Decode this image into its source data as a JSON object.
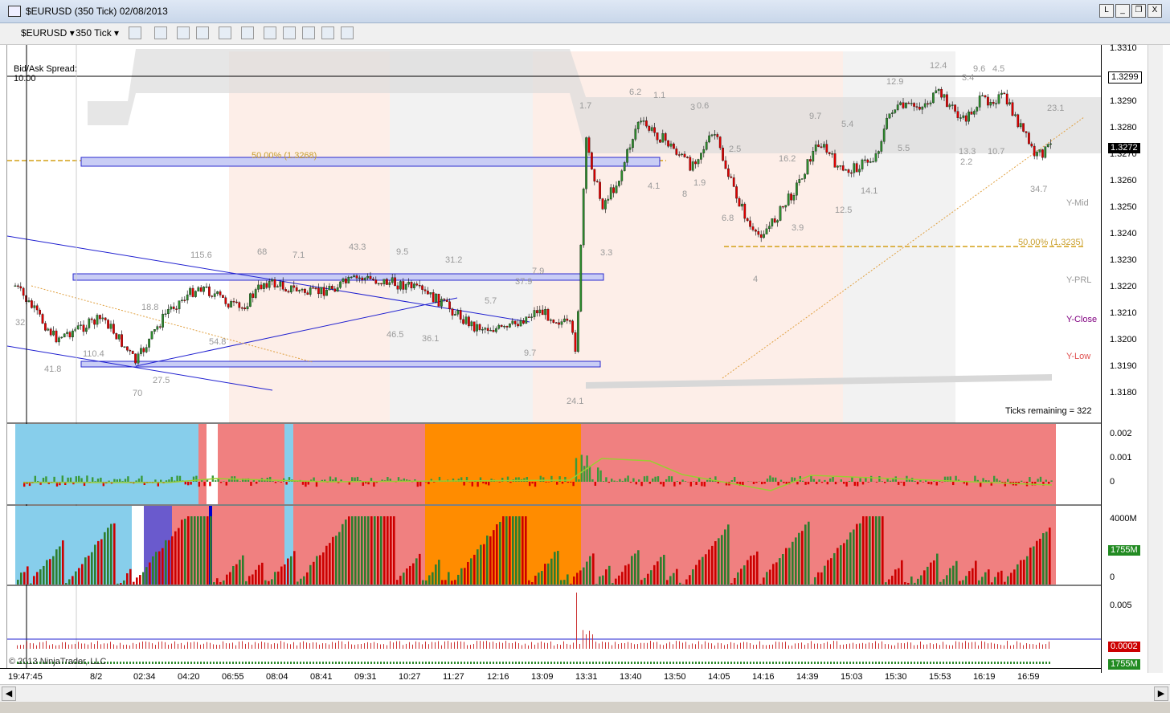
{
  "window": {
    "title": "$EURUSD (350 Tick)  02/08/2013",
    "buttons": [
      "L",
      "_",
      "❐",
      "X"
    ]
  },
  "toolbar": {
    "instrument": "$EURUSD",
    "interval": "350 Tick"
  },
  "chart": {
    "bid_ask_label": "Bid/Ask Spread:",
    "bid_ask_value": "10.00",
    "ticks_remaining": "Ticks remaining = 322",
    "fib_label_left": "50.00% (1.3268)",
    "fib_label_right": "50.00% (1.3235)",
    "legend": [
      "Y-Mid",
      "Y-PRL",
      "Y-Close",
      "Y-Low"
    ],
    "vol_labels": [
      {
        "t": "12.4"
      },
      {
        "t": "9.6"
      },
      {
        "t": "4.5"
      },
      {
        "t": "12.9"
      },
      {
        "t": "3.4"
      },
      {
        "t": "6.2"
      },
      {
        "t": "1.1"
      },
      {
        "t": "1.7"
      },
      {
        "t": "3"
      },
      {
        "t": "0.6"
      },
      {
        "t": "9.7"
      },
      {
        "t": "5.4"
      },
      {
        "t": "23.1"
      },
      {
        "t": "2.5"
      },
      {
        "t": "16.2"
      },
      {
        "t": "5.5"
      },
      {
        "t": "13.3"
      },
      {
        "t": "10.7"
      },
      {
        "t": "2.2"
      },
      {
        "t": "4.1"
      },
      {
        "t": "8"
      },
      {
        "t": "1.9"
      },
      {
        "t": "14.1"
      },
      {
        "t": "34.7"
      },
      {
        "t": "12.5"
      },
      {
        "t": "6.8"
      },
      {
        "t": "3.9"
      },
      {
        "t": "3.3"
      },
      {
        "t": "4"
      },
      {
        "t": "115.6"
      },
      {
        "t": "68"
      },
      {
        "t": "7.1"
      },
      {
        "t": "43.3"
      },
      {
        "t": "9.5"
      },
      {
        "t": "31.2"
      },
      {
        "t": "7.9"
      },
      {
        "t": "37.9"
      },
      {
        "t": "5.7"
      },
      {
        "t": "18.8"
      },
      {
        "t": "54.8"
      },
      {
        "t": "46.5"
      },
      {
        "t": "36.1"
      },
      {
        "t": "9.7"
      },
      {
        "t": "110.4"
      },
      {
        "t": "41.8"
      },
      {
        "t": "27.5"
      },
      {
        "t": "70"
      },
      {
        "t": "24.1"
      },
      {
        "t": "32"
      }
    ]
  },
  "price_axis": {
    "ticks": [
      "1.3310",
      "1.3300",
      "1.3290",
      "1.3280",
      "1.3270",
      "1.3260",
      "1.3250",
      "1.3240",
      "1.3230",
      "1.3220",
      "1.3210",
      "1.3200",
      "1.3190",
      "1.3180"
    ],
    "current_price": "1.3272",
    "line_price": "1.3299"
  },
  "indicator1": {
    "ticks": [
      "0.002",
      "0.001",
      "0"
    ]
  },
  "indicator2": {
    "ticks": [
      "4000M",
      "0"
    ],
    "current": "1755M"
  },
  "indicator3": {
    "ticks": [
      "0.005"
    ],
    "current": "0.0002",
    "current2": "1755M"
  },
  "copyright": "© 2013 NinjaTrader, LLC",
  "time_axis": [
    "19:47:45",
    "8/2",
    "02:34",
    "04:20",
    "06:55",
    "08:04",
    "08:41",
    "09:31",
    "10:27",
    "11:27",
    "12:16",
    "13:09",
    "13:31",
    "13:40",
    "13:50",
    "14:05",
    "14:16",
    "14:39",
    "15:03",
    "15:30",
    "15:53",
    "16:19",
    "16:59"
  ],
  "colors": {
    "session_red": "#f08080",
    "session_blue": "#87ceeb",
    "session_orange": "#ff8c00",
    "bull": "#2e8b2e",
    "bear": "#dd0000"
  }
}
